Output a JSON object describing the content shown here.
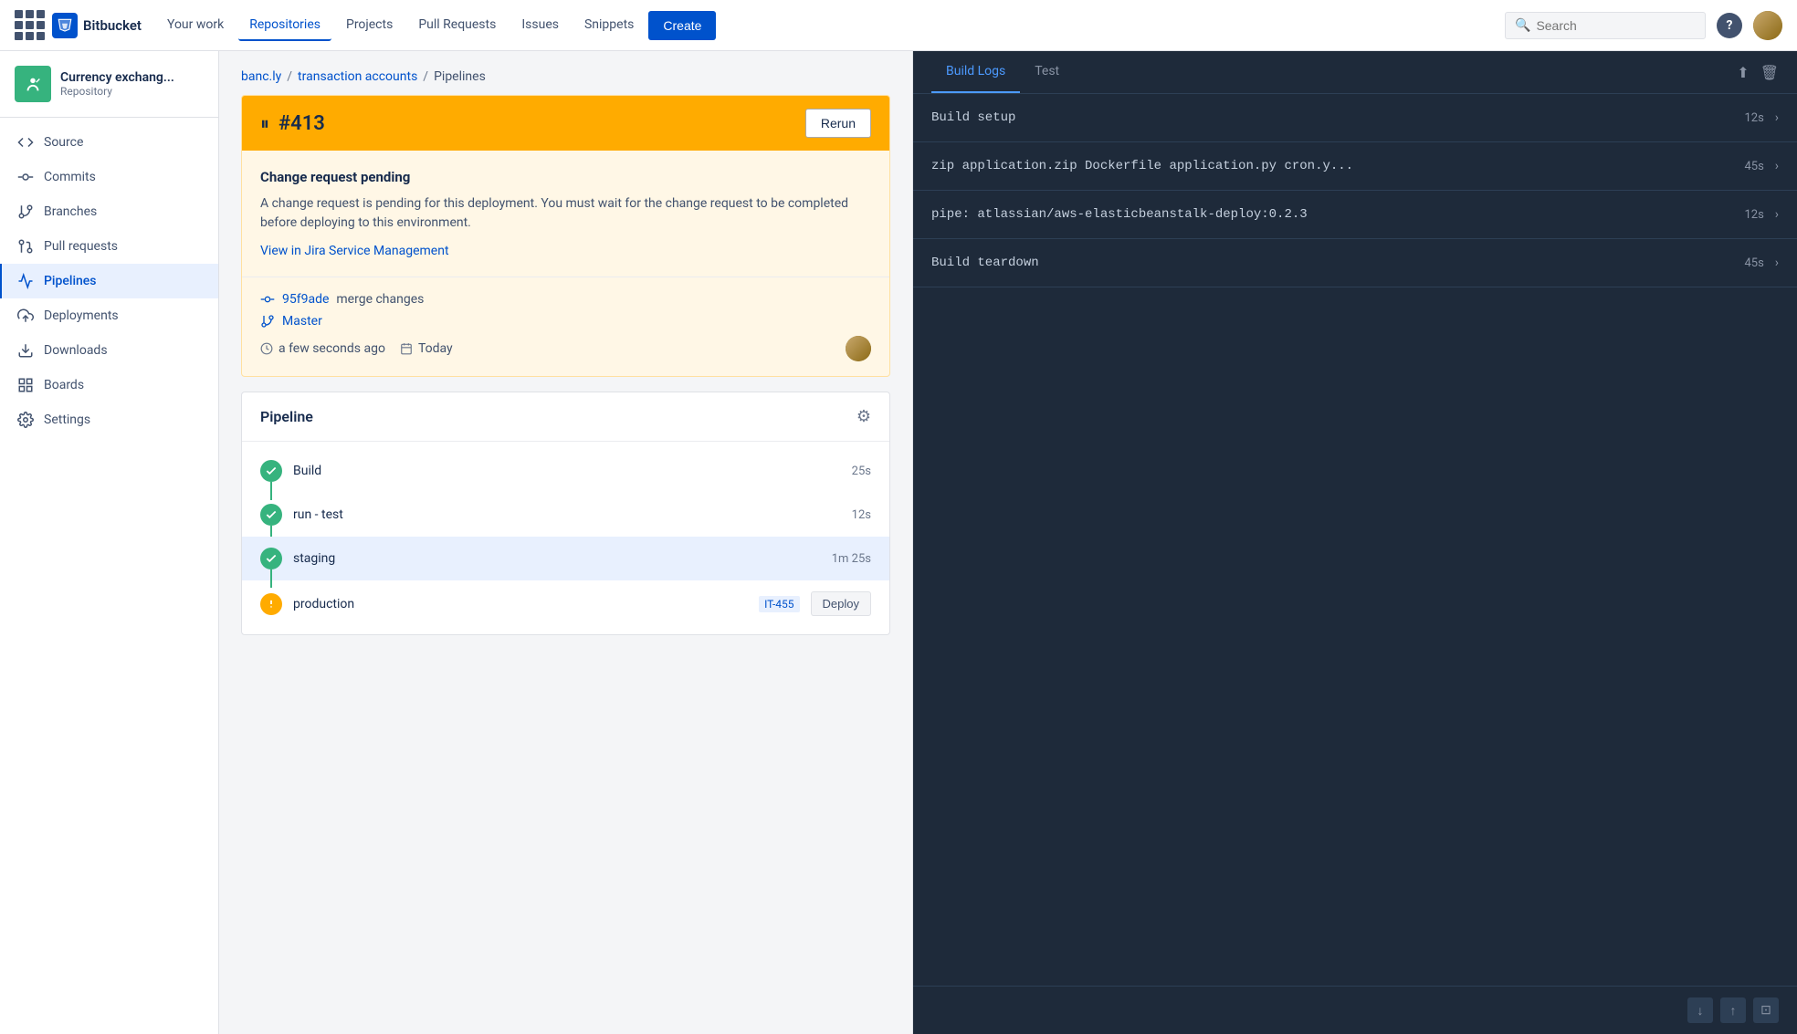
{
  "topnav": {
    "logo_text": "Bitbucket",
    "nav_items": [
      {
        "label": "Your work",
        "active": false
      },
      {
        "label": "Repositories",
        "active": true
      },
      {
        "label": "Projects",
        "active": false
      },
      {
        "label": "Pull Requests",
        "active": false
      },
      {
        "label": "Issues",
        "active": false
      },
      {
        "label": "Snippets",
        "active": false
      }
    ],
    "create_label": "Create",
    "search_placeholder": "Search"
  },
  "sidebar": {
    "repo_name": "Currency exchang...",
    "repo_type": "Repository",
    "nav_items": [
      {
        "label": "Source",
        "icon": "source-icon",
        "active": false
      },
      {
        "label": "Commits",
        "icon": "commits-icon",
        "active": false
      },
      {
        "label": "Branches",
        "icon": "branches-icon",
        "active": false
      },
      {
        "label": "Pull requests",
        "icon": "pullrequest-icon",
        "active": false
      },
      {
        "label": "Pipelines",
        "icon": "pipelines-icon",
        "active": true
      },
      {
        "label": "Deployments",
        "icon": "deployments-icon",
        "active": false
      },
      {
        "label": "Downloads",
        "icon": "downloads-icon",
        "active": false
      },
      {
        "label": "Boards",
        "icon": "boards-icon",
        "active": false
      },
      {
        "label": "Settings",
        "icon": "settings-icon",
        "active": false
      }
    ]
  },
  "breadcrumb": {
    "parts": [
      "banc.ly",
      "transaction accounts",
      "Pipelines"
    ],
    "separators": [
      "/",
      "/"
    ]
  },
  "pipeline": {
    "number": "#413",
    "rerun_label": "Rerun",
    "change_request_title": "Change request pending",
    "change_request_text": "A change request is pending for this deployment. You must wait for the change request to be completed before deploying to this environment.",
    "change_request_link": "View in Jira Service Management",
    "commit_hash": "95f9ade",
    "commit_message": "merge changes",
    "branch": "Master",
    "time": "a few seconds ago",
    "date_icon_text": "Today",
    "pipeline_title": "Pipeline",
    "steps": [
      {
        "label": "Build",
        "status": "green",
        "duration": "25s"
      },
      {
        "label": "run - test",
        "status": "green",
        "duration": "12s"
      },
      {
        "label": "staging",
        "status": "green",
        "duration": "1m 25s",
        "active": true
      },
      {
        "label": "production",
        "status": "yellow",
        "badge": "IT-455",
        "deploy_label": "Deploy"
      }
    ]
  },
  "build_logs": {
    "tabs": [
      {
        "label": "Build Logs",
        "active": true
      },
      {
        "label": "Test",
        "active": false
      }
    ],
    "entries": [
      {
        "text": "Build setup",
        "duration": "12s"
      },
      {
        "text": "zip application.zip Dockerfile application.py cron.y...",
        "duration": "45s"
      },
      {
        "text": "pipe: atlassian/aws-elasticbeanstalk-deploy:0.2.3",
        "duration": "12s"
      },
      {
        "text": "Build teardown",
        "duration": "45s"
      }
    ]
  }
}
